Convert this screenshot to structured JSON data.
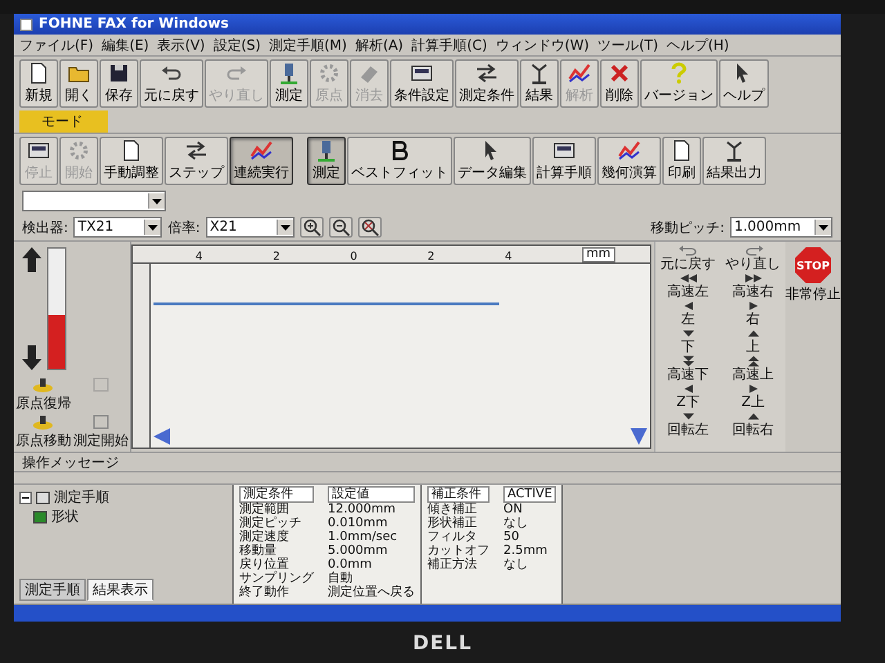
{
  "window": {
    "title": "FOHNE FAX for Windows"
  },
  "menu": [
    "ファイル(F)",
    "編集(E)",
    "表示(V)",
    "設定(S)",
    "測定手順(M)",
    "解析(A)",
    "計算手順(C)",
    "ウィンドウ(W)",
    "ツール(T)",
    "ヘルプ(H)"
  ],
  "toolbar": [
    {
      "label": "新規",
      "disabled": false
    },
    {
      "label": "開く",
      "disabled": false
    },
    {
      "label": "保存",
      "disabled": false
    },
    {
      "label": "元に戻す",
      "disabled": false
    },
    {
      "label": "やり直し",
      "disabled": true
    },
    {
      "label": "測定",
      "disabled": false
    },
    {
      "label": "原点",
      "disabled": true
    },
    {
      "label": "消去",
      "disabled": true
    },
    {
      "label": "条件設定",
      "disabled": false
    },
    {
      "label": "測定条件",
      "disabled": false
    },
    {
      "label": "結果",
      "disabled": false
    },
    {
      "label": "解析",
      "disabled": true
    },
    {
      "label": "削除",
      "disabled": false
    },
    {
      "label": "バージョン",
      "disabled": false
    },
    {
      "label": "ヘルプ",
      "disabled": false
    }
  ],
  "mode_tab": {
    "label": "モード",
    "selected": true
  },
  "toolbar2": [
    {
      "label": "停止",
      "disabled": true,
      "pressed": false
    },
    {
      "label": "開始",
      "disabled": true,
      "pressed": false
    },
    {
      "label": "手動調整",
      "disabled": false,
      "pressed": false
    },
    {
      "label": "ステップ",
      "disabled": false,
      "pressed": false
    },
    {
      "label": "連続実行",
      "disabled": false,
      "pressed": true
    },
    {
      "label": "測定",
      "disabled": false,
      "pressed": true
    },
    {
      "label": "ベストフィット",
      "disabled": false,
      "pressed": false
    },
    {
      "label": "データ編集",
      "disabled": false,
      "pressed": false
    },
    {
      "label": "計算手順",
      "disabled": false,
      "pressed": false
    },
    {
      "label": "幾何演算",
      "disabled": false,
      "pressed": false
    },
    {
      "label": "印刷",
      "disabled": false,
      "pressed": false
    },
    {
      "label": "結果出力",
      "disabled": false,
      "pressed": false
    }
  ],
  "settings": [
    {
      "label": "検出器:",
      "value": "TX21"
    },
    {
      "label": "倍率:",
      "value": "X21"
    },
    {
      "label": "移動ピッチ:",
      "value": "1.000mm"
    }
  ],
  "gauge": {
    "level": 0.45
  },
  "side_buttons": [
    {
      "label": "原点復帰",
      "disabled": false
    },
    {
      "disabled": true
    },
    {
      "label": "原点移動",
      "disabled": false
    },
    {
      "label": "測定開始",
      "disabled": false
    }
  ],
  "ruler_labels": [
    "4",
    "2",
    "0",
    "2",
    "4"
  ],
  "unit": "mm",
  "pad": [
    {
      "label": "元に戻す"
    },
    {
      "label": "やり直し"
    },
    {
      "label": "高速左"
    },
    {
      "label": "高速右"
    },
    {
      "label": "左"
    },
    {
      "label": "右"
    },
    {
      "label": "下"
    },
    {
      "label": "上"
    },
    {
      "label": "高速下"
    },
    {
      "label": "高速上"
    },
    {
      "label": "Z下"
    },
    {
      "label": "Z上"
    },
    {
      "label": "回転左"
    },
    {
      "label": "回転右"
    }
  ],
  "stop": {
    "sign": "STOP",
    "label": "非常停止"
  },
  "message_label": "操作メッセージ",
  "tree": [
    {
      "label": "測定手順",
      "expanded": true,
      "children": [
        {
          "label": "形状"
        }
      ]
    }
  ],
  "bottom_tabs": [
    {
      "label": "測定手順",
      "selected": false
    },
    {
      "label": "結果表示",
      "selected": true
    }
  ],
  "table1": {
    "columns": [
      "測定条件",
      "設定値"
    ],
    "rows": [
      [
        "測定範囲",
        "12.000mm"
      ],
      [
        "測定ピッチ",
        "0.010mm"
      ],
      [
        "測定速度",
        "1.0mm/sec"
      ],
      [
        "移動量",
        "5.000mm"
      ],
      [
        "戻り位置",
        "0.0mm"
      ],
      [
        "サンプリング",
        "自動"
      ],
      [
        "終了動作",
        "測定位置へ戻る"
      ]
    ]
  },
  "table2": {
    "columns": [
      "補正条件",
      "ACTIVE"
    ],
    "rows": [
      [
        "傾き補正",
        "ON"
      ],
      [
        "形状補正",
        "なし"
      ],
      [
        "フィルタ",
        "50"
      ],
      [
        "カットオフ",
        "2.5mm"
      ],
      [
        "補正方法",
        "なし"
      ]
    ]
  },
  "monitor_brand": "DELL"
}
